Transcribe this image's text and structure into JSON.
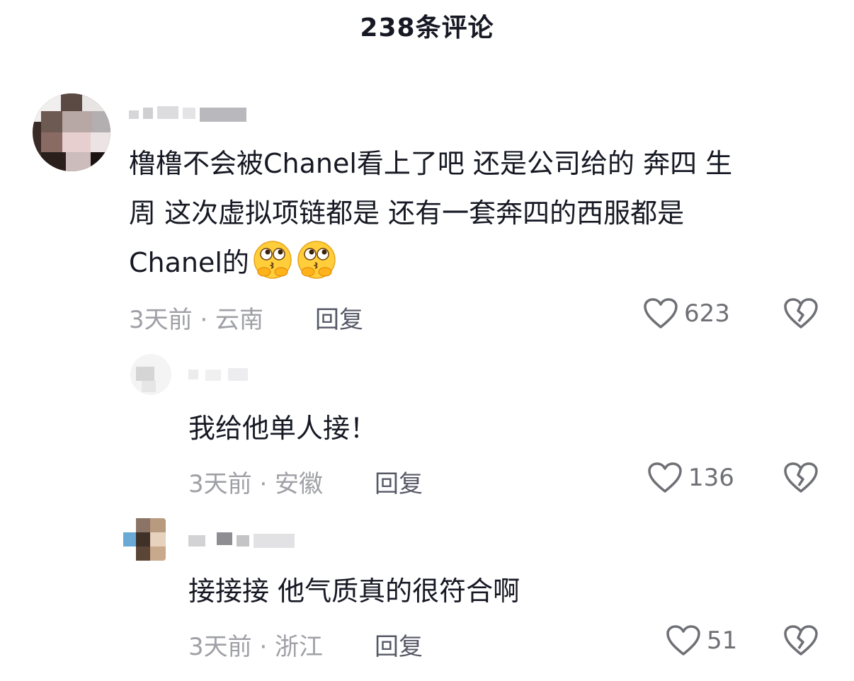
{
  "header": {
    "title": "238条评论"
  },
  "comments": [
    {
      "username_visible": "",
      "text_lines": [
        "橹橹不会被Chanel看上了吧 还是公司给的 奔四 生",
        "周 这次虚拟项链都是 还有一套奔四的西服都是",
        "Chanel的"
      ],
      "emojis": [
        "thinking-kiss-emoji",
        "thinking-kiss-emoji"
      ],
      "meta": "3天前 · 云南",
      "reply_label": "回复",
      "likes": "623"
    },
    {
      "username_visible": "",
      "text": "我给他单人接！",
      "meta": "3天前 · 安徽",
      "reply_label": "回复",
      "likes": "136"
    },
    {
      "username_visible": "",
      "text": "接接接 他气质真的很符合啊",
      "meta": "3天前 · 浙江",
      "reply_label": "回复",
      "likes": "51"
    }
  ],
  "icons": {
    "like": "heart-outline-icon",
    "dislike": "broken-heart-icon"
  },
  "colors": {
    "primary_text": "#161823",
    "secondary_text": "#9fa0a6",
    "reply_text": "#565866",
    "icon": "#6f7075"
  }
}
